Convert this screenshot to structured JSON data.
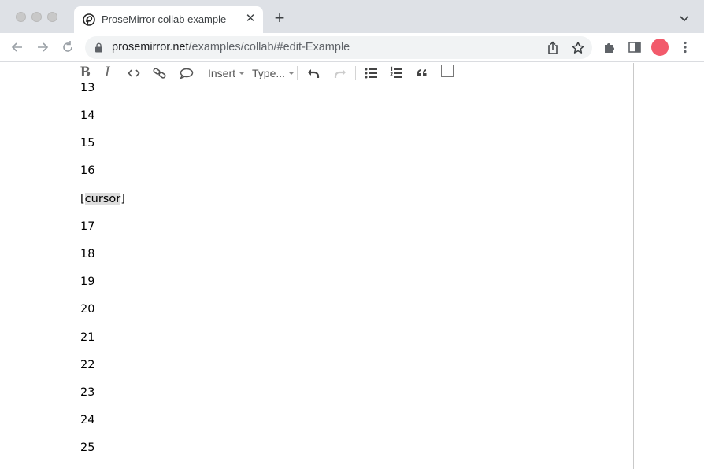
{
  "browser": {
    "tab": {
      "title": "ProseMirror collab example",
      "close_glyph": "✕"
    },
    "new_tab_glyph": "+",
    "address": {
      "host": "prosemirror.net",
      "path": "/examples/collab/#edit-Example"
    }
  },
  "menubar": {
    "bold_label": "B",
    "italic_label": "I",
    "insert_label": "Insert",
    "type_label": "Type..."
  },
  "document": {
    "paragraphs": [
      "13",
      "14",
      "15",
      "16",
      "[cursor]",
      "17",
      "18",
      "19",
      "20",
      "21",
      "22",
      "23",
      "24",
      "25"
    ],
    "cursor_open": "[",
    "cursor_word": "cursor",
    "cursor_close": "]"
  },
  "colors": {
    "chrome_bg": "#dee1e6",
    "omnibox_bg": "#f1f3f4",
    "avatar": "#f25a6b",
    "cursor_highlight": "#dddddd"
  }
}
